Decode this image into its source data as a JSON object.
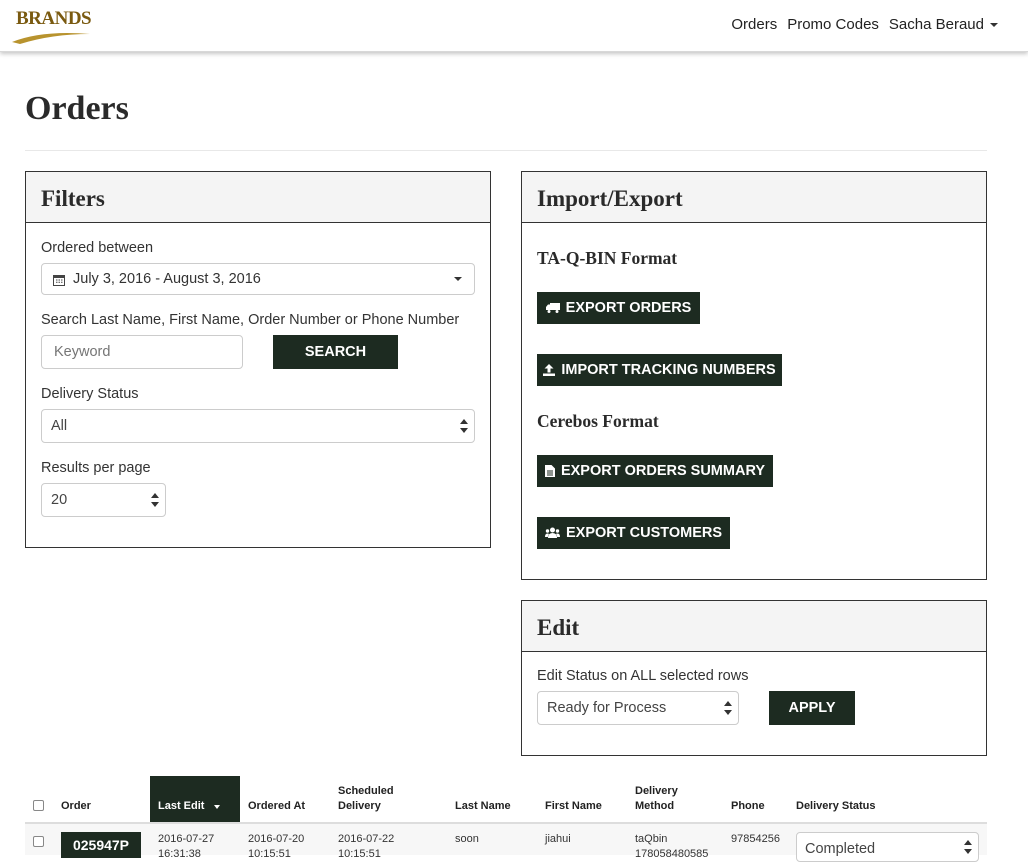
{
  "brand": {
    "logo_text": "BRANDS"
  },
  "nav": {
    "orders": "Orders",
    "promo_codes": "Promo Codes",
    "user": "Sacha Beraud"
  },
  "page": {
    "title": "Orders"
  },
  "filters": {
    "title": "Filters",
    "ordered_between_label": "Ordered between",
    "date_range": "July 3, 2016 - August 3, 2016",
    "search_label": "Search Last Name, First Name, Order Number or Phone Number",
    "keyword_placeholder": "Keyword",
    "search_button": "SEARCH",
    "delivery_status_label": "Delivery Status",
    "delivery_status_value": "All",
    "results_label": "Results per page",
    "results_value": "20"
  },
  "import_export": {
    "title": "Import/Export",
    "taqbin_heading": "TA-Q-BIN Format",
    "export_orders": "EXPORT ORDERS",
    "import_tracking": "IMPORT TRACKING NUMBERS",
    "cerebos_heading": "Cerebos Format",
    "export_summary": "EXPORT ORDERS SUMMARY",
    "export_customers": "EXPORT CUSTOMERS"
  },
  "edit": {
    "title": "Edit",
    "label": "Edit Status on ALL selected rows",
    "status_value": "Ready for Process",
    "apply_button": "APPLY"
  },
  "table": {
    "headers": {
      "order": "Order",
      "last_edit": "Last Edit",
      "ordered_at": "Ordered At",
      "scheduled_1": "Scheduled",
      "scheduled_2": "Delivery",
      "last_name": "Last Name",
      "first_name": "First Name",
      "delivery_1": "Delivery",
      "delivery_2": "Method",
      "phone": "Phone",
      "delivery_status": "Delivery Status"
    },
    "rows": [
      {
        "order": "025947P",
        "last_edit_date": "2016-07-27",
        "last_edit_time": "16:31:38",
        "ordered_date": "2016-07-20",
        "ordered_time": "10:15:51",
        "scheduled_date": "2016-07-22",
        "scheduled_time": "10:15:51",
        "last_name": "soon",
        "first_name": "jiahui",
        "method": "taQbin",
        "tracking": "178058480585",
        "phone": "97854256",
        "status": "Completed"
      }
    ]
  },
  "colors": {
    "button_dark": "#1d2b21",
    "accent_gold": "#7a5a10"
  }
}
